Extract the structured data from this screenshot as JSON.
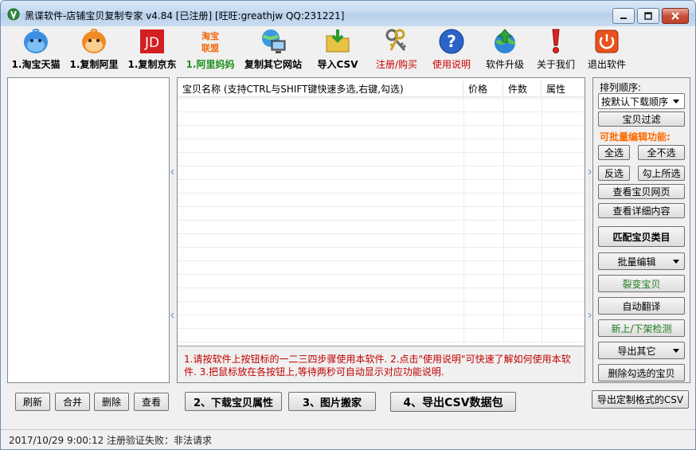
{
  "window": {
    "title": "黑谍软件-店铺宝贝复制专家  v4.84 [已注册] [旺旺:greathjw QQ:231221]"
  },
  "toolbar": {
    "items": [
      {
        "label": "1.淘宝天猫",
        "icon": "taobao-doll-icon",
        "color": "#000000"
      },
      {
        "label": "1.复制阿里",
        "icon": "alibaba-doll-icon",
        "color": "#000000"
      },
      {
        "label": "1.复制京东",
        "icon": "jd-logo-icon",
        "color": "#000000"
      },
      {
        "label": "1.阿里妈妈",
        "icon": "taobao-union-logo-icon",
        "color": "#1e8f1e"
      },
      {
        "label": "复制其它网站",
        "icon": "computer-globe-icon",
        "color": "#000000"
      },
      {
        "label": "导入CSV",
        "icon": "folder-import-icon",
        "color": "#000000"
      },
      {
        "label": "注册/购买",
        "icon": "keys-icon",
        "color": "#cc0000"
      },
      {
        "label": "使用说明",
        "icon": "help-icon",
        "color": "#cc0000"
      },
      {
        "label": "软件升级",
        "icon": "globe-upgrade-icon",
        "color": "#000000"
      },
      {
        "label": "关于我们",
        "icon": "exclamation-icon",
        "color": "#000000"
      },
      {
        "label": "退出软件",
        "icon": "power-icon",
        "color": "#000000"
      }
    ]
  },
  "list": {
    "columns": [
      "宝贝名称 (支持CTRL与SHIFT键快速多选,右键,勾选)",
      "价格",
      "件数",
      "属性"
    ],
    "hint": "1.请按软件上按钮标的一二三四步骤使用本软件. 2.点击\"使用说明\"可快速了解如何使用本软件. 3.把鼠标放在各按钮上,等待两秒可自动显示对应功能说明."
  },
  "right_panel": {
    "sort_label": "排列顺序:",
    "sort_value": "按默认下载顺序",
    "filter_button": "宝贝过滤",
    "batch_label": "可批量编辑功能:",
    "select_all": "全选",
    "select_none": "全不选",
    "invert": "反选",
    "check_selected": "勾上所选",
    "view_page": "查看宝贝网页",
    "view_detail": "查看详细内容",
    "match_category": "匹配宝贝类目",
    "batch_edit": "批量编辑",
    "split_item": "裂变宝贝",
    "auto_translate": "自动翻译",
    "shelf_check": "新上/下架检测",
    "export_other": "导出其它",
    "delete_checked": "删除勾选的宝贝",
    "export_custom_csv": "导出定制格式的CSV"
  },
  "bottom": {
    "refresh": "刷新",
    "merge": "合并",
    "delete": "删除",
    "view": "查看",
    "step2": "2、下载宝贝属性",
    "step3": "3、图片搬家",
    "step4": "4、导出CSV数据包"
  },
  "status": {
    "text": "2017/10/29 9:00:12  注册验证失败：非法请求"
  }
}
